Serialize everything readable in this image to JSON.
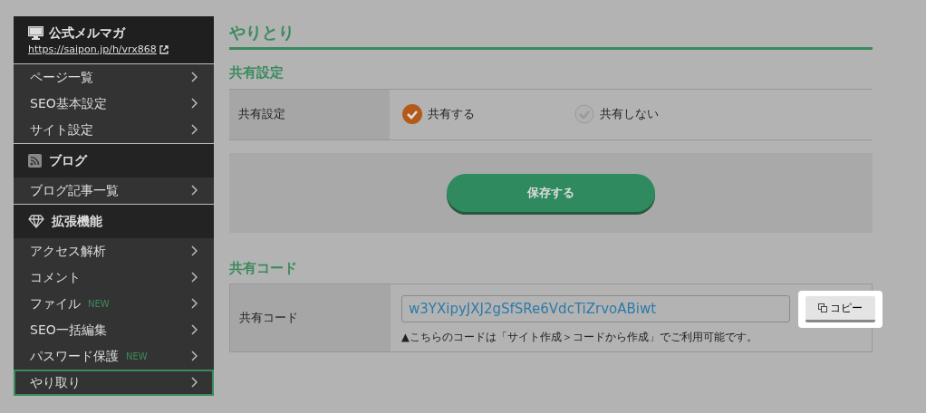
{
  "sidebar": {
    "header": {
      "title": "公式メルマガ",
      "link": "https://saipon.jp/h/vrx868"
    },
    "sections": [
      {
        "items": [
          {
            "label": "ページ一覧",
            "selected": false
          },
          {
            "label": "SEO基本設定",
            "selected": false
          },
          {
            "label": "サイト設定",
            "selected": false
          }
        ]
      },
      {
        "title": "ブログ",
        "items": [
          {
            "label": "ブログ記事一覧",
            "selected": false
          }
        ]
      },
      {
        "title": "拡張機能",
        "items": [
          {
            "label": "アクセス解析",
            "selected": false
          },
          {
            "label": "コメント",
            "selected": false
          },
          {
            "label": "ファイル",
            "badge": "NEW",
            "selected": false
          },
          {
            "label": "SEO一括編集",
            "selected": false
          },
          {
            "label": "パスワード保護",
            "badge": "NEW",
            "selected": false
          },
          {
            "label": "やり取り",
            "selected": true
          }
        ]
      }
    ]
  },
  "page_title": "やりとり",
  "share_settings": {
    "heading": "共有設定",
    "label": "共有設定",
    "options": [
      {
        "label": "共有する",
        "selected": true
      },
      {
        "label": "共有しない",
        "selected": false
      }
    ],
    "save_button": "保存する"
  },
  "share_code": {
    "heading": "共有コード",
    "label": "共有コード",
    "value": "w3YXipyJXJ2gSfSRe6VdcTiZrvoABiwt",
    "copy_button": "コピー",
    "note": "▲こちらのコードは「サイト作成＞コードから作成」でご利用可能です。"
  }
}
